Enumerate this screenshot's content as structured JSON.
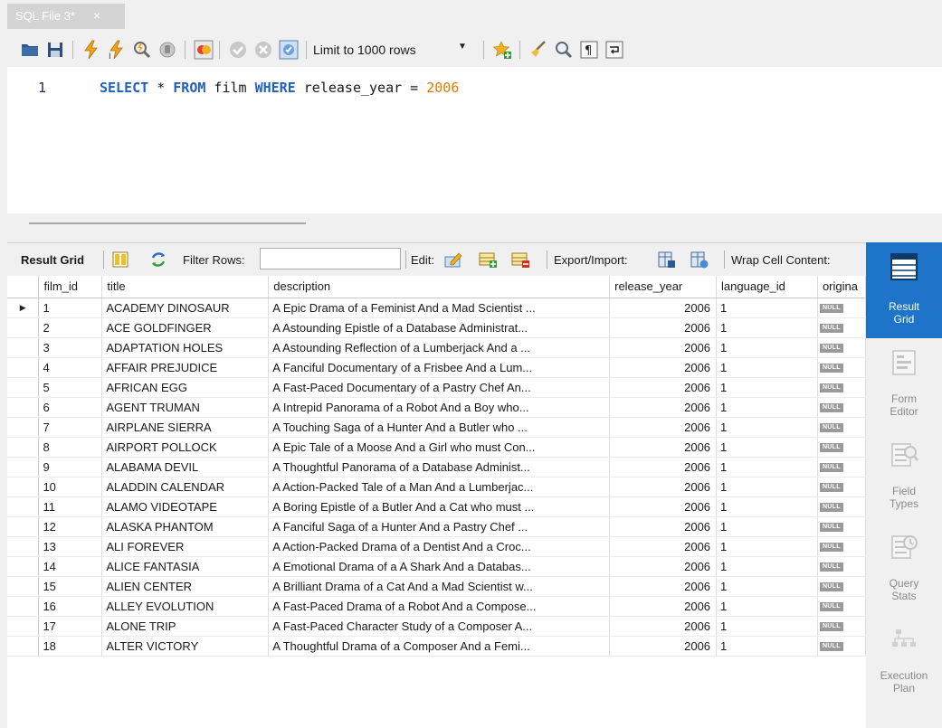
{
  "tab": {
    "title": "SQL File 3*",
    "close": "×"
  },
  "toolbar": {
    "limit_label": "Limit to 1000 rows",
    "icons": [
      "open-folder-icon",
      "save-icon",
      "execute-icon",
      "execute-current-icon",
      "explain-icon",
      "stop-icon",
      "toggle-error-icon",
      "commit-icon",
      "rollback-icon",
      "autocommit-icon",
      "add-snippet-icon",
      "beautify-icon",
      "find-icon",
      "invisible-chars-icon",
      "wrap-lines-icon"
    ]
  },
  "editor": {
    "line_number": "1",
    "tokens": [
      {
        "t": "SELECT",
        "k": "kw"
      },
      {
        "t": " * ",
        "k": ""
      },
      {
        "t": "FROM",
        "k": "kw"
      },
      {
        "t": " film ",
        "k": ""
      },
      {
        "t": "WHERE",
        "k": "kw"
      },
      {
        "t": " release_year = ",
        "k": ""
      },
      {
        "t": "2006",
        "k": "num"
      }
    ]
  },
  "result_toolbar": {
    "result_grid": "Result Grid",
    "filter_rows": "Filter Rows:",
    "filter_value": "",
    "edit": "Edit:",
    "export_import": "Export/Import:",
    "wrap": "Wrap Cell Content:"
  },
  "grid": {
    "columns": [
      "film_id",
      "title",
      "description",
      "release_year",
      "language_id",
      "origina"
    ],
    "null_text": "NULL",
    "rows": [
      {
        "id": "1",
        "title": "ACADEMY DINOSAUR",
        "desc": "A Epic Drama of a Feminist And a Mad Scientist ...",
        "year": "2006",
        "lang": "1"
      },
      {
        "id": "2",
        "title": "ACE GOLDFINGER",
        "desc": "A Astounding Epistle of a Database Administrat...",
        "year": "2006",
        "lang": "1"
      },
      {
        "id": "3",
        "title": "ADAPTATION HOLES",
        "desc": "A Astounding Reflection of a Lumberjack And a ...",
        "year": "2006",
        "lang": "1"
      },
      {
        "id": "4",
        "title": "AFFAIR PREJUDICE",
        "desc": "A Fanciful Documentary of a Frisbee And a Lum...",
        "year": "2006",
        "lang": "1"
      },
      {
        "id": "5",
        "title": "AFRICAN EGG",
        "desc": "A Fast-Paced Documentary of a Pastry Chef An...",
        "year": "2006",
        "lang": "1"
      },
      {
        "id": "6",
        "title": "AGENT TRUMAN",
        "desc": "A Intrepid Panorama of a Robot And a Boy who...",
        "year": "2006",
        "lang": "1"
      },
      {
        "id": "7",
        "title": "AIRPLANE SIERRA",
        "desc": "A Touching Saga of a Hunter And a Butler who ...",
        "year": "2006",
        "lang": "1"
      },
      {
        "id": "8",
        "title": "AIRPORT POLLOCK",
        "desc": "A Epic Tale of a Moose And a Girl who must Con...",
        "year": "2006",
        "lang": "1"
      },
      {
        "id": "9",
        "title": "ALABAMA DEVIL",
        "desc": "A Thoughtful Panorama of a Database Administ...",
        "year": "2006",
        "lang": "1"
      },
      {
        "id": "10",
        "title": "ALADDIN CALENDAR",
        "desc": "A Action-Packed Tale of a Man And a Lumberjac...",
        "year": "2006",
        "lang": "1"
      },
      {
        "id": "11",
        "title": "ALAMO VIDEOTAPE",
        "desc": "A Boring Epistle of a Butler And a Cat who must ...",
        "year": "2006",
        "lang": "1"
      },
      {
        "id": "12",
        "title": "ALASKA PHANTOM",
        "desc": "A Fanciful Saga of a Hunter And a Pastry Chef ...",
        "year": "2006",
        "lang": "1"
      },
      {
        "id": "13",
        "title": "ALI FOREVER",
        "desc": "A Action-Packed Drama of a Dentist And a Croc...",
        "year": "2006",
        "lang": "1"
      },
      {
        "id": "14",
        "title": "ALICE FANTASIA",
        "desc": "A Emotional Drama of a A Shark And a Databas...",
        "year": "2006",
        "lang": "1"
      },
      {
        "id": "15",
        "title": "ALIEN CENTER",
        "desc": "A Brilliant Drama of a Cat And a Mad Scientist w...",
        "year": "2006",
        "lang": "1"
      },
      {
        "id": "16",
        "title": "ALLEY EVOLUTION",
        "desc": "A Fast-Paced Drama of a Robot And a Compose...",
        "year": "2006",
        "lang": "1"
      },
      {
        "id": "17",
        "title": "ALONE TRIP",
        "desc": "A Fast-Paced Character Study of a Composer A...",
        "year": "2006",
        "lang": "1"
      },
      {
        "id": "18",
        "title": "ALTER VICTORY",
        "desc": "A Thoughtful Drama of a Composer And a Femi...",
        "year": "2006",
        "lang": "1"
      }
    ]
  },
  "side_panel": {
    "items": [
      {
        "label": "Result\nGrid",
        "active": true
      },
      {
        "label": "Form\nEditor",
        "active": false
      },
      {
        "label": "Field\nTypes",
        "active": false
      },
      {
        "label": "Query\nStats",
        "active": false
      },
      {
        "label": "Execution\nPlan",
        "active": false
      }
    ]
  },
  "colors": {
    "keyword": "#1f5fbf",
    "number": "#e07a00",
    "accent": "#1e74c8",
    "tab": "#d4d4d4"
  }
}
